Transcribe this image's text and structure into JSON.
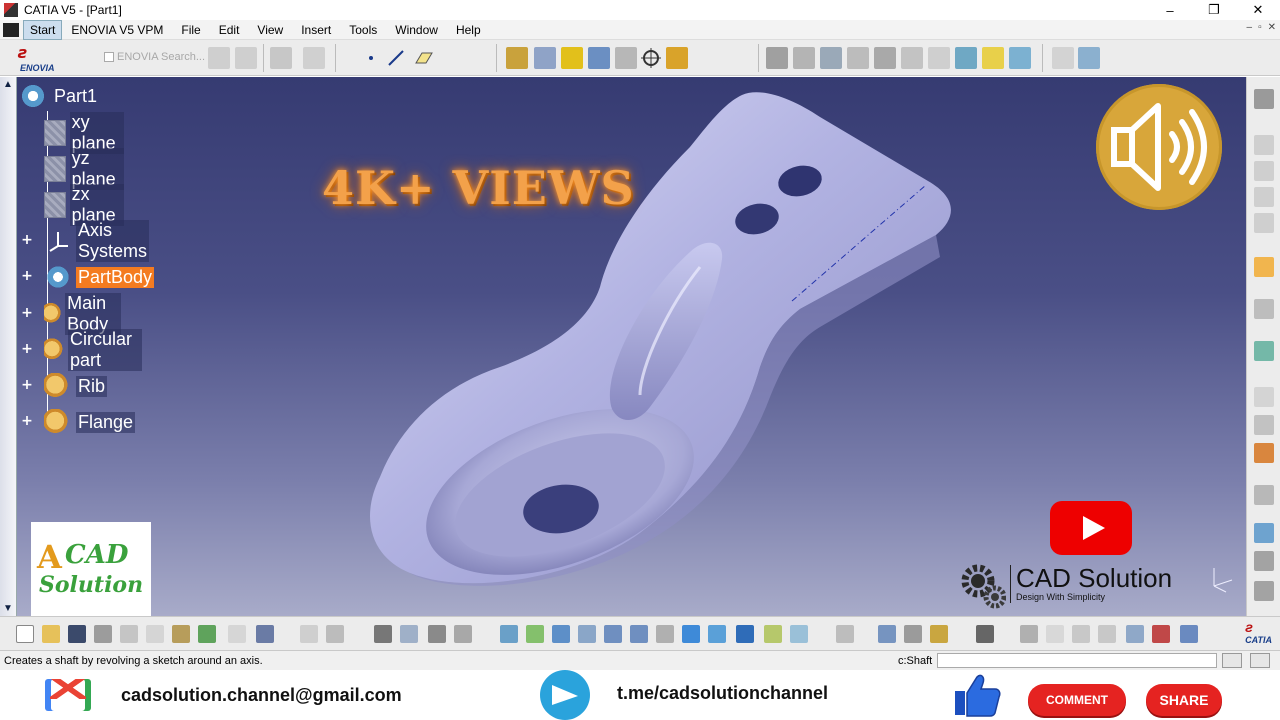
{
  "window": {
    "title": "CATIA V5 - [Part1]",
    "minimize": "–",
    "maximize": "❐",
    "close": "✕"
  },
  "menubar": {
    "items": [
      "Start",
      "ENOVIA V5 VPM",
      "File",
      "Edit",
      "View",
      "Insert",
      "Tools",
      "Window",
      "Help"
    ],
    "inner_controls": [
      "–",
      "▫",
      "✕"
    ]
  },
  "toolbar_top": {
    "enovia_logo_text": "ENOVIA",
    "enovia_search": "ENOVIA Search..."
  },
  "tree": {
    "root": "Part1",
    "nodes": [
      {
        "label": "xy plane",
        "icon": "plane-icon",
        "expandable": false
      },
      {
        "label": "yz plane",
        "icon": "plane-icon",
        "expandable": false
      },
      {
        "label": "zx plane",
        "icon": "plane-icon",
        "expandable": false
      },
      {
        "label": "Axis Systems",
        "icon": "axis-system-icon",
        "expandable": true
      },
      {
        "label": "PartBody",
        "icon": "partbody-gear-icon",
        "expandable": true,
        "selected": true
      },
      {
        "label": "Main Body",
        "icon": "geometrical-set-icon",
        "expandable": true
      },
      {
        "label": "Circular part",
        "icon": "geometrical-set-icon",
        "expandable": true
      },
      {
        "label": "Rib",
        "icon": "geometrical-set-icon",
        "expandable": true
      },
      {
        "label": "Flange",
        "icon": "geometrical-set-icon",
        "expandable": true
      }
    ]
  },
  "overlay": {
    "views_text": "4K+ VIEWS",
    "logo_line1": "CAD",
    "logo_line2": "Solution",
    "brand_name": "CAD Solution",
    "brand_tagline": "Design With Simplicity",
    "compass_labels": "z y x"
  },
  "toolbar_bottom": {
    "catia_logo_text": "CATIA"
  },
  "statusbar": {
    "message": "Creates a shaft by revolving a sketch around an axis.",
    "command_label": "c:Shaft",
    "command_value": ""
  },
  "footer": {
    "email": "cadsolution.channel@gmail.com",
    "telegram": "t.me/cadsolutionchannel",
    "comment_label": "COMMENT",
    "share_label": "SHARE"
  },
  "colors": {
    "selected_node": "#f47b20",
    "viewport_top": "#363b72",
    "viewport_bottom": "#a8abc9",
    "part_surface": "#b8b9e6",
    "views_text": "#f3a14a",
    "speaker_badge": "#d8a63a",
    "youtube_red": "#e00000",
    "button_red": "#e52321"
  }
}
